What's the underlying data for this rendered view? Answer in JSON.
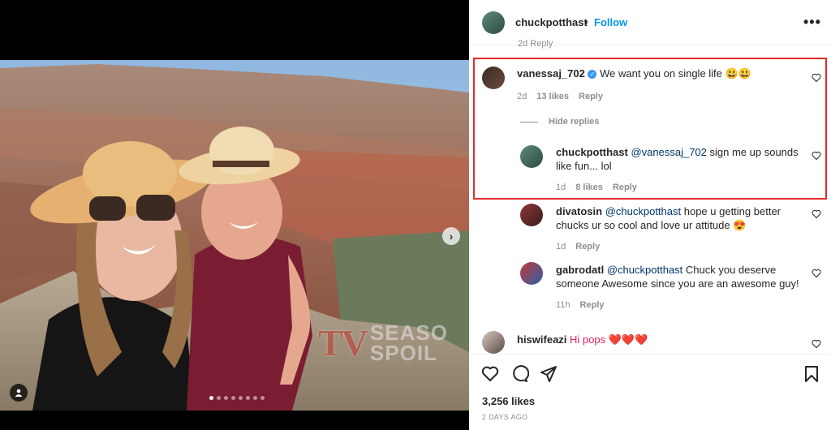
{
  "post": {
    "author": "chuckpotthast",
    "separator": "•",
    "follow_label": "Follow",
    "more_label": "•••",
    "partial_row": "2d   Reply",
    "image_count": 8,
    "active_image_index": 0
  },
  "watermark": {
    "logo": "TV",
    "line1": "SEASO",
    "line2": "SPOIL"
  },
  "comments": [
    {
      "user": "vanessaj_702",
      "verified": true,
      "text": "We want you on single life 😃😃",
      "time": "2d",
      "likes": "13 likes",
      "reply_label": "Reply",
      "hide_replies": "Hide replies"
    },
    {
      "user": "chuckpotthast",
      "mention": "@vanessaj_702",
      "text": " sign me up sounds like fun... lol",
      "time": "1d",
      "likes": "8 likes",
      "reply_label": "Reply"
    },
    {
      "user": "divatosin",
      "mention": "@chuckpotthast",
      "text": " hope u getting better chucks ur so cool and love ur attitude 😍",
      "time": "1d",
      "reply_label": "Reply"
    },
    {
      "user": "gabrodatl",
      "mention": "@chuckpotthast",
      "text": " Chuck you deserve someone Awesome since you are an awesome guy!",
      "time": "11h",
      "reply_label": "Reply"
    },
    {
      "user": "hiswifeazi",
      "text": "Hi pops ❤️❤️❤️"
    }
  ],
  "footer": {
    "likes": "3,256 likes",
    "posted": "2 DAYS AGO"
  },
  "colors": {
    "highlight": "#e52b2b",
    "link": "#0095f6",
    "mention": "#00376b"
  }
}
